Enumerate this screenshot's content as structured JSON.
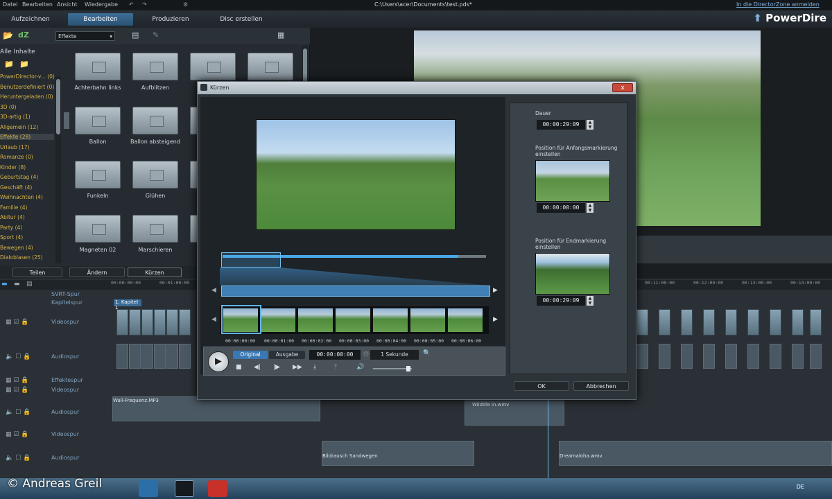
{
  "window": {
    "title": "C:\\Users\\acer\\Documents\\test.pds*",
    "login_link": "In die DirectorZone anmelden",
    "brand": "PowerDire"
  },
  "menu": [
    "Datei",
    "Bearbeiten",
    "Ansicht",
    "Wiedergabe"
  ],
  "main_tabs": [
    {
      "label": "Aufzeichnen",
      "active": false
    },
    {
      "label": "Bearbeiten",
      "active": true
    },
    {
      "label": "Produzieren",
      "active": false
    },
    {
      "label": "Disc erstellen",
      "active": false
    }
  ],
  "library": {
    "filter_value": "Effekte",
    "all_content": "Alle Inhalte",
    "categories": [
      {
        "label": "PowerDirector-v... (0)"
      },
      {
        "label": "Benutzerdefiniert (0)"
      },
      {
        "label": "Heruntergeladen (0)"
      },
      {
        "label": "3D (0)"
      },
      {
        "label": "3D-artig (1)"
      },
      {
        "label": "Allgemein (12)"
      },
      {
        "label": "Effekte (28)",
        "selected": true
      },
      {
        "label": "Urlaub (17)"
      },
      {
        "label": "Romanze (0)"
      },
      {
        "label": "Kinder (8)"
      },
      {
        "label": "Geburtstag (4)"
      },
      {
        "label": "Geschäft (4)"
      },
      {
        "label": "Weihnachten (4)"
      },
      {
        "label": "Familie (4)"
      },
      {
        "label": "Abitur (4)"
      },
      {
        "label": "Party (4)"
      },
      {
        "label": "Sport (4)"
      },
      {
        "label": "Bewegen (4)"
      },
      {
        "label": "Dialoblasen (25)"
      }
    ],
    "tiles": [
      [
        "Achterbahn links",
        "Aufblitzen",
        "",
        ""
      ],
      [
        "Ballon",
        "Ballon absteigend",
        "D",
        ""
      ],
      [
        "Funkeln",
        "Glühen",
        "",
        ""
      ],
      [
        "Magneten 02",
        "Marschieren",
        "",
        ""
      ]
    ],
    "actions": [
      "Teilen",
      "Ändern",
      "Kürzen"
    ]
  },
  "timeline": {
    "ruler": [
      "00:00:00:00",
      "00:01:00:00",
      "00:11:00:00",
      "00:12:00:00",
      "00:13:00:00",
      "00:14:00:00"
    ],
    "chapter": "1. Kapitel 1",
    "tracks": [
      {
        "label": "SVRT-Spur"
      },
      {
        "label": "Kapitelspur"
      },
      {
        "label": "Videospur"
      },
      {
        "label": "Audiospur"
      },
      {
        "label": "Effektespur"
      },
      {
        "label": "Videospur"
      },
      {
        "label": "Audiospur"
      },
      {
        "label": "Videospur"
      },
      {
        "label": "Audiospur"
      }
    ],
    "audio_clips": [
      "Wall-Frequenz.MP3",
      "Wildlife in.wmv",
      "Bildrausch Sandwegen",
      "Dreamaloha.wmv"
    ]
  },
  "dialog": {
    "title": "Kürzen",
    "close": "x",
    "right": {
      "duration_label": "Dauer",
      "duration": "00:00:29:09",
      "start_label": "Position für Anfangsmarkierung einstellen",
      "start": "00:00:00:00",
      "end_label": "Position für Endmarkierung einstellen",
      "end": "00:00:29:09"
    },
    "film_ticks": [
      "00:00:00:00",
      "00:00:01:00",
      "00:00:02:00",
      "00:00:03:00",
      "00:00:04:00",
      "00:00:05:00",
      "00:00:06:00"
    ],
    "mode_original": "Original",
    "mode_output": "Ausgabe",
    "timecode": "00:00:00:00",
    "interval": "1 Sekunde",
    "ok": "OK",
    "cancel": "Abbrechen"
  },
  "credit": "© Andreas Greil",
  "taskbar": {
    "lang": "DE"
  },
  "colors": {
    "accent": "#3d6f98",
    "category": "#d7b24a",
    "close": "#c74b3a"
  }
}
